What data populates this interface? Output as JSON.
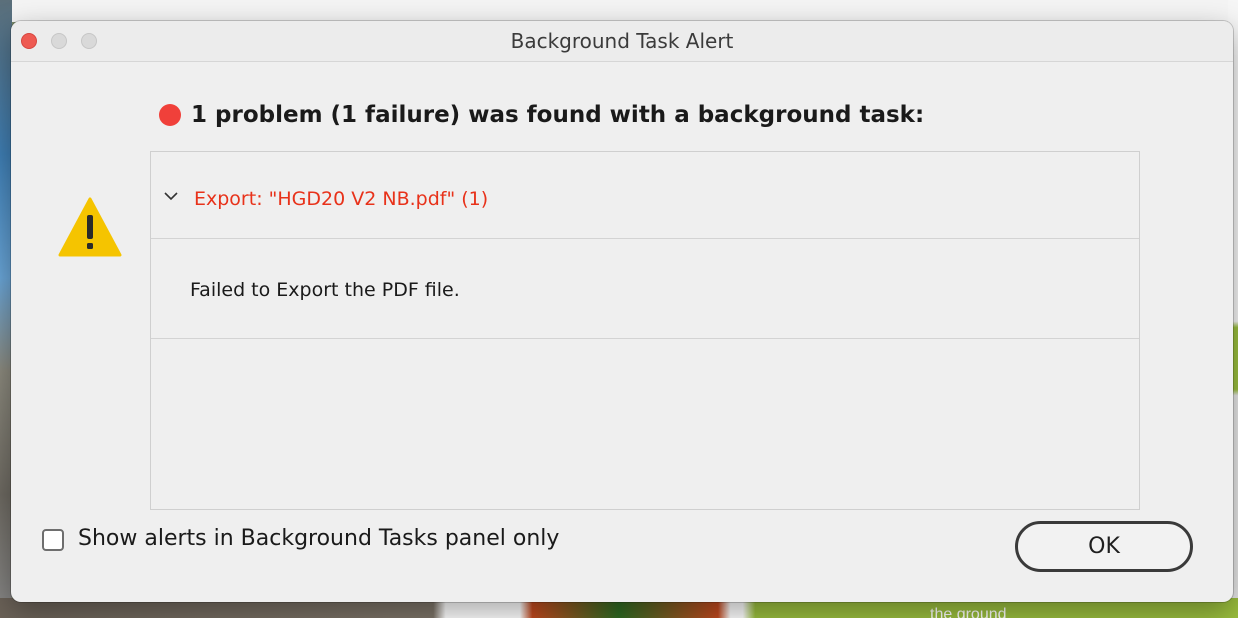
{
  "window": {
    "title": "Background Task Alert",
    "controls": [
      "close",
      "minimize",
      "zoom"
    ]
  },
  "alert": {
    "status_icon": "red-dot-icon",
    "status_color": "#f0403a",
    "warning_icon": "warning-triangle-icon",
    "warning_color": "#f5c400",
    "heading": "1 problem (1 failure) was found with a background task:"
  },
  "tasks": [
    {
      "expand_icon": "chevron-down-icon",
      "label": "Export: \"HGD20 V2 NB.pdf\" (1)",
      "label_color": "#e8321a",
      "details": [
        "Failed to Export the PDF file."
      ]
    }
  ],
  "footer": {
    "checkbox_label": "Show alerts in Background Tasks panel only",
    "checkbox_checked": false,
    "ok_label": "OK"
  },
  "background": {
    "partial_text": "the ground"
  }
}
